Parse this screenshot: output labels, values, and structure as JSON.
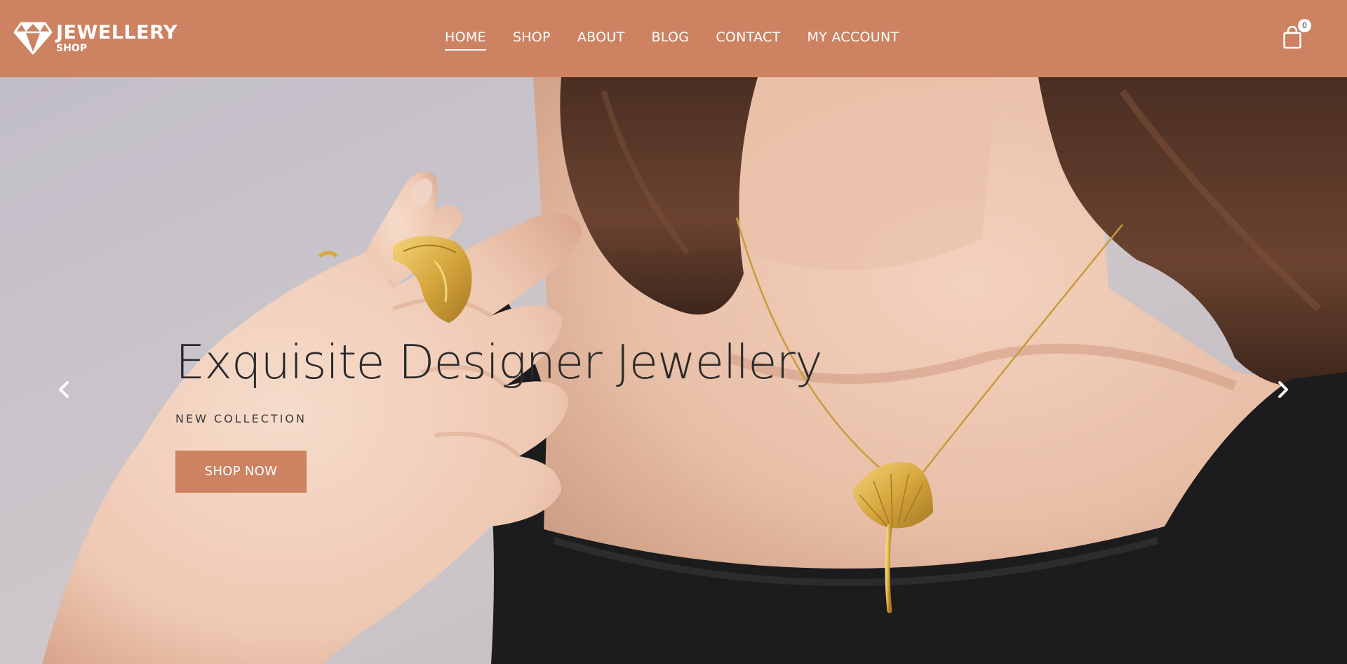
{
  "brand": {
    "name": "JEWELLERY",
    "tagline": "SHOP",
    "icon": "diamond-icon"
  },
  "nav": {
    "items": [
      {
        "label": "HOME",
        "active": true
      },
      {
        "label": "SHOP",
        "active": false
      },
      {
        "label": "ABOUT",
        "active": false
      },
      {
        "label": "BLOG",
        "active": false
      },
      {
        "label": "CONTACT",
        "active": false
      },
      {
        "label": "MY ACCOUNT",
        "active": false
      }
    ]
  },
  "cart": {
    "icon": "shopping-bag-icon",
    "count": "0"
  },
  "hero": {
    "title": "Exquisite Designer Jewellery",
    "subtitle": "NEW COLLECTION",
    "cta_label": "SHOP NOW",
    "prev_icon": "chevron-left-icon",
    "next_icon": "chevron-right-icon"
  },
  "colors": {
    "header_bg": "#cd8262",
    "accent": "#cd8262",
    "header_text": "#ffffff",
    "hero_text": "#2a2a2a"
  }
}
